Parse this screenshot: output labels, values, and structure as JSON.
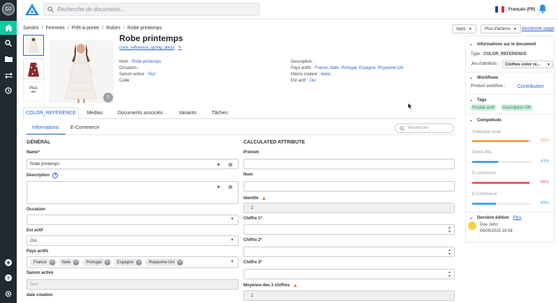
{
  "user": {
    "initials": "DJ"
  },
  "search": {
    "placeholder": "Recherche de documents..."
  },
  "lang": {
    "label": "Français (FR)"
  },
  "breadcrumb": [
    "Sandro",
    "Femmes",
    "Prêt-à-porter",
    "Robes",
    "Robe printemps"
  ],
  "toolbar": {
    "apps": "Apps",
    "more": "Plus d'actions",
    "old_page": "Ancienne page"
  },
  "thumbs": {
    "more_label": "Plus",
    "more_dots": "•••"
  },
  "image_count": "5",
  "doc": {
    "title": "Robe printemps",
    "reference": "color_reference_spring_dress"
  },
  "meta_left": [
    {
      "k": "Nom :",
      "v": "Robe printemps"
    },
    {
      "k": "Occasion :",
      "v": ""
    },
    {
      "k": "Saison active :",
      "v": "Test"
    },
    {
      "k": "Code :",
      "v": ""
    }
  ],
  "meta_right": [
    {
      "k": "Description :",
      "v": ""
    },
    {
      "k": "Pays actifs :",
      "v": "France, Italie, Portugal, Espagne, Royaume-Uni"
    },
    {
      "k": "Macro couleur :",
      "v": "blanc"
    },
    {
      "k": "Est actif :",
      "v": "Oui"
    }
  ],
  "tabs": [
    "COLOR_REFERENCE",
    "Medias",
    "Documents associés",
    "Variants",
    "Tâches"
  ],
  "subtabs": [
    "Informations",
    "E-Commerce"
  ],
  "field_search": {
    "placeholder": "Recherche"
  },
  "general": {
    "heading": "GÉNÉRAL",
    "name_label": "Name*",
    "name_value": "Robe printemps",
    "description_label": "Description",
    "occasion_label": "Occasion",
    "occasion_value": "",
    "active_label": "Est actif",
    "active_value": "Oui",
    "countries_label": "Pays actifs",
    "countries": [
      "France",
      "Italie",
      "Portugal",
      "Espagne",
      "Royaume-Uni"
    ],
    "season_label": "Saison active",
    "season_value": "Test",
    "date_label": "date création"
  },
  "calculated": {
    "heading": "CALCULATED ATTRIBUTE",
    "prenom_label": "Prénom",
    "nom_label": "Nom",
    "identite_label": "Identité",
    "c1_label": "Chiffre 1*",
    "c2_label": "Chiffre 2*",
    "c3_label": "Chiffre 3*",
    "avg_label": "Moyenne des 3 chiffres",
    "sigma": "Σ"
  },
  "right_panel": {
    "info_heading": "Informations sur le document",
    "type_label": "Type :",
    "type_value": "COLOR_REFERENCE",
    "attr_label": "Jeu d'attributs :",
    "attr_value": "Clothes color re...",
    "workflows_heading": "Workflows",
    "workflow_label": "Product workflow :",
    "workflow_value": "Contribution",
    "tags_heading": "Tags",
    "tags": [
      "Produit actif",
      "Description OK"
    ],
    "completude_heading": "Complétude",
    "completude": [
      {
        "label": "Collection book",
        "pct": "95%",
        "value": 95,
        "color": "#f0a04b"
      },
      {
        "label": "Démo PAL",
        "pct": "43%",
        "value": 43,
        "color": "#4aa3e8"
      },
      {
        "label": "E-commerce",
        "pct": "96%",
        "value": 96,
        "color": "#e95a6f"
      },
      {
        "label": "E-Commerce",
        "pct": "40%",
        "value": 40,
        "color": "#4aa3e8"
      }
    ],
    "last_edit_heading": "Dernière édition",
    "last_edit_more": "Plus",
    "last_edit_user": "Doe John",
    "last_edit_date": "06/05/2025 16:08"
  },
  "colors": {
    "accent": "#14c8a0",
    "link": "#2a61c9",
    "sidebar": "#1f2a33"
  }
}
